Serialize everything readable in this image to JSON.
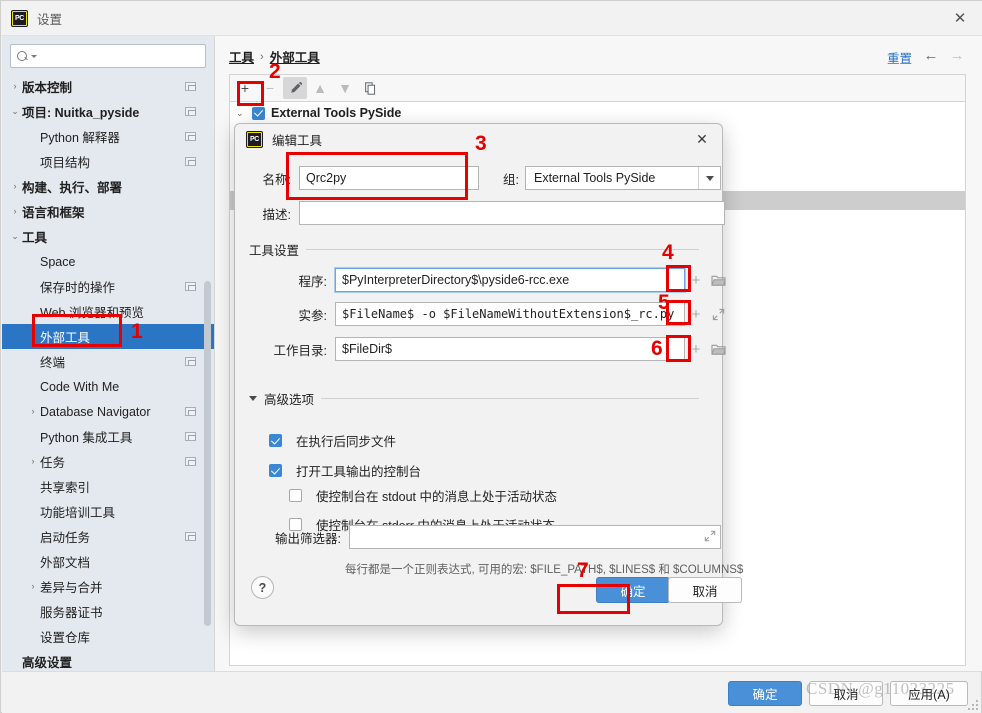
{
  "window": {
    "title": "设置",
    "app_icon": "PC",
    "close_label": "✕"
  },
  "sidebar": {
    "search": {
      "value": "",
      "placeholder": ""
    },
    "items": [
      {
        "label": "版本控制",
        "indent": 0,
        "arrow": "›",
        "bold": true,
        "box": true,
        "selected": false
      },
      {
        "label": "项目: Nuitka_pyside",
        "indent": 0,
        "arrow": "⌄",
        "bold": true,
        "box": true,
        "selected": false
      },
      {
        "label": "Python 解释器",
        "indent": 1,
        "arrow": "",
        "bold": false,
        "box": true,
        "selected": false
      },
      {
        "label": "项目结构",
        "indent": 1,
        "arrow": "",
        "bold": false,
        "box": true,
        "selected": false
      },
      {
        "label": "构建、执行、部署",
        "indent": 0,
        "arrow": "›",
        "bold": true,
        "box": false,
        "selected": false
      },
      {
        "label": "语言和框架",
        "indent": 0,
        "arrow": "›",
        "bold": true,
        "box": false,
        "selected": false
      },
      {
        "label": "工具",
        "indent": 0,
        "arrow": "⌄",
        "bold": true,
        "box": false,
        "selected": false
      },
      {
        "label": "Space",
        "indent": 1,
        "arrow": "",
        "bold": false,
        "box": false,
        "selected": false
      },
      {
        "label": "保存时的操作",
        "indent": 1,
        "arrow": "",
        "bold": false,
        "box": true,
        "selected": false
      },
      {
        "label": "Web 浏览器和预览",
        "indent": 1,
        "arrow": "",
        "bold": false,
        "box": false,
        "selected": false
      },
      {
        "label": "外部工具",
        "indent": 1,
        "arrow": "",
        "bold": false,
        "box": false,
        "selected": true
      },
      {
        "label": "终端",
        "indent": 1,
        "arrow": "",
        "bold": false,
        "box": true,
        "selected": false
      },
      {
        "label": "Code With Me",
        "indent": 1,
        "arrow": "",
        "bold": false,
        "box": false,
        "selected": false
      },
      {
        "label": "Database Navigator",
        "indent": 1,
        "arrow": "›",
        "bold": false,
        "box": true,
        "selected": false
      },
      {
        "label": "Python 集成工具",
        "indent": 1,
        "arrow": "",
        "bold": false,
        "box": true,
        "selected": false
      },
      {
        "label": "任务",
        "indent": 1,
        "arrow": "›",
        "bold": false,
        "box": true,
        "selected": false
      },
      {
        "label": "共享索引",
        "indent": 1,
        "arrow": "",
        "bold": false,
        "box": false,
        "selected": false
      },
      {
        "label": "功能培训工具",
        "indent": 1,
        "arrow": "",
        "bold": false,
        "box": false,
        "selected": false
      },
      {
        "label": "启动任务",
        "indent": 1,
        "arrow": "",
        "bold": false,
        "box": true,
        "selected": false
      },
      {
        "label": "外部文档",
        "indent": 1,
        "arrow": "",
        "bold": false,
        "box": false,
        "selected": false
      },
      {
        "label": "差异与合并",
        "indent": 1,
        "arrow": "›",
        "bold": false,
        "box": false,
        "selected": false
      },
      {
        "label": "服务器证书",
        "indent": 1,
        "arrow": "",
        "bold": false,
        "box": false,
        "selected": false
      },
      {
        "label": "设置仓库",
        "indent": 1,
        "arrow": "",
        "bold": false,
        "box": false,
        "selected": false
      },
      {
        "label": "高级设置",
        "indent": 0,
        "arrow": "",
        "bold": true,
        "box": false,
        "selected": false
      }
    ]
  },
  "main": {
    "breadcrumb": {
      "parent": "工具",
      "separator": "›",
      "current": "外部工具"
    },
    "reset_label": "重置",
    "nav_back": "←",
    "nav_forward": "→",
    "toolbar": {
      "add": "+",
      "remove": "−",
      "edit": "edit-pencil",
      "move_up": "▲",
      "move_down": "▼",
      "copy": "copy"
    },
    "tree": {
      "group_arrow": "⌄",
      "group_name": "External Tools PySide",
      "group_checked": true
    }
  },
  "dialog": {
    "title": "编辑工具",
    "app_icon": "PC",
    "close_label": "✕",
    "name_label": "名称:",
    "name_value": "Qrc2py",
    "group_label": "组:",
    "group_value": "External Tools PySide",
    "desc_label": "描述:",
    "desc_value": "",
    "tool_settings_label": "工具设置",
    "program_label": "程序:",
    "program_value": "$PyInterpreterDirectory$\\pyside6-rcc.exe",
    "arguments_label": "实参:",
    "arguments_value": "$FileName$ -o $FileNameWithoutExtension$_rc.py",
    "workdir_label": "工作目录:",
    "workdir_value": "$FileDir$",
    "advanced_label": "高级选项",
    "checkboxes": [
      {
        "label": "在执行后同步文件",
        "checked": true,
        "indent": 0
      },
      {
        "label": "打开工具输出的控制台",
        "checked": true,
        "indent": 0
      },
      {
        "label": "使控制台在 stdout 中的消息上处于活动状态",
        "checked": false,
        "indent": 1
      },
      {
        "label": "使控制台在 stderr 中的消息上处于活动状态",
        "checked": false,
        "indent": 1
      }
    ],
    "output_filter_label": "输出筛选器:",
    "output_filter_value": "",
    "hint": "每行都是一个正则表达式, 可用的宏: $FILE_PATH$, $LINES$ 和 $COLUMNS$",
    "help_label": "?",
    "ok_label": "确定",
    "cancel_label": "取消"
  },
  "footer": {
    "ok_label": "确定",
    "cancel_label": "取消",
    "apply_label": "应用(A)"
  },
  "annotations": {
    "numbers": [
      "1",
      "2",
      "3",
      "4",
      "5",
      "6",
      "7"
    ],
    "color": "#e60000"
  },
  "watermark": "CSDN @g11023225"
}
